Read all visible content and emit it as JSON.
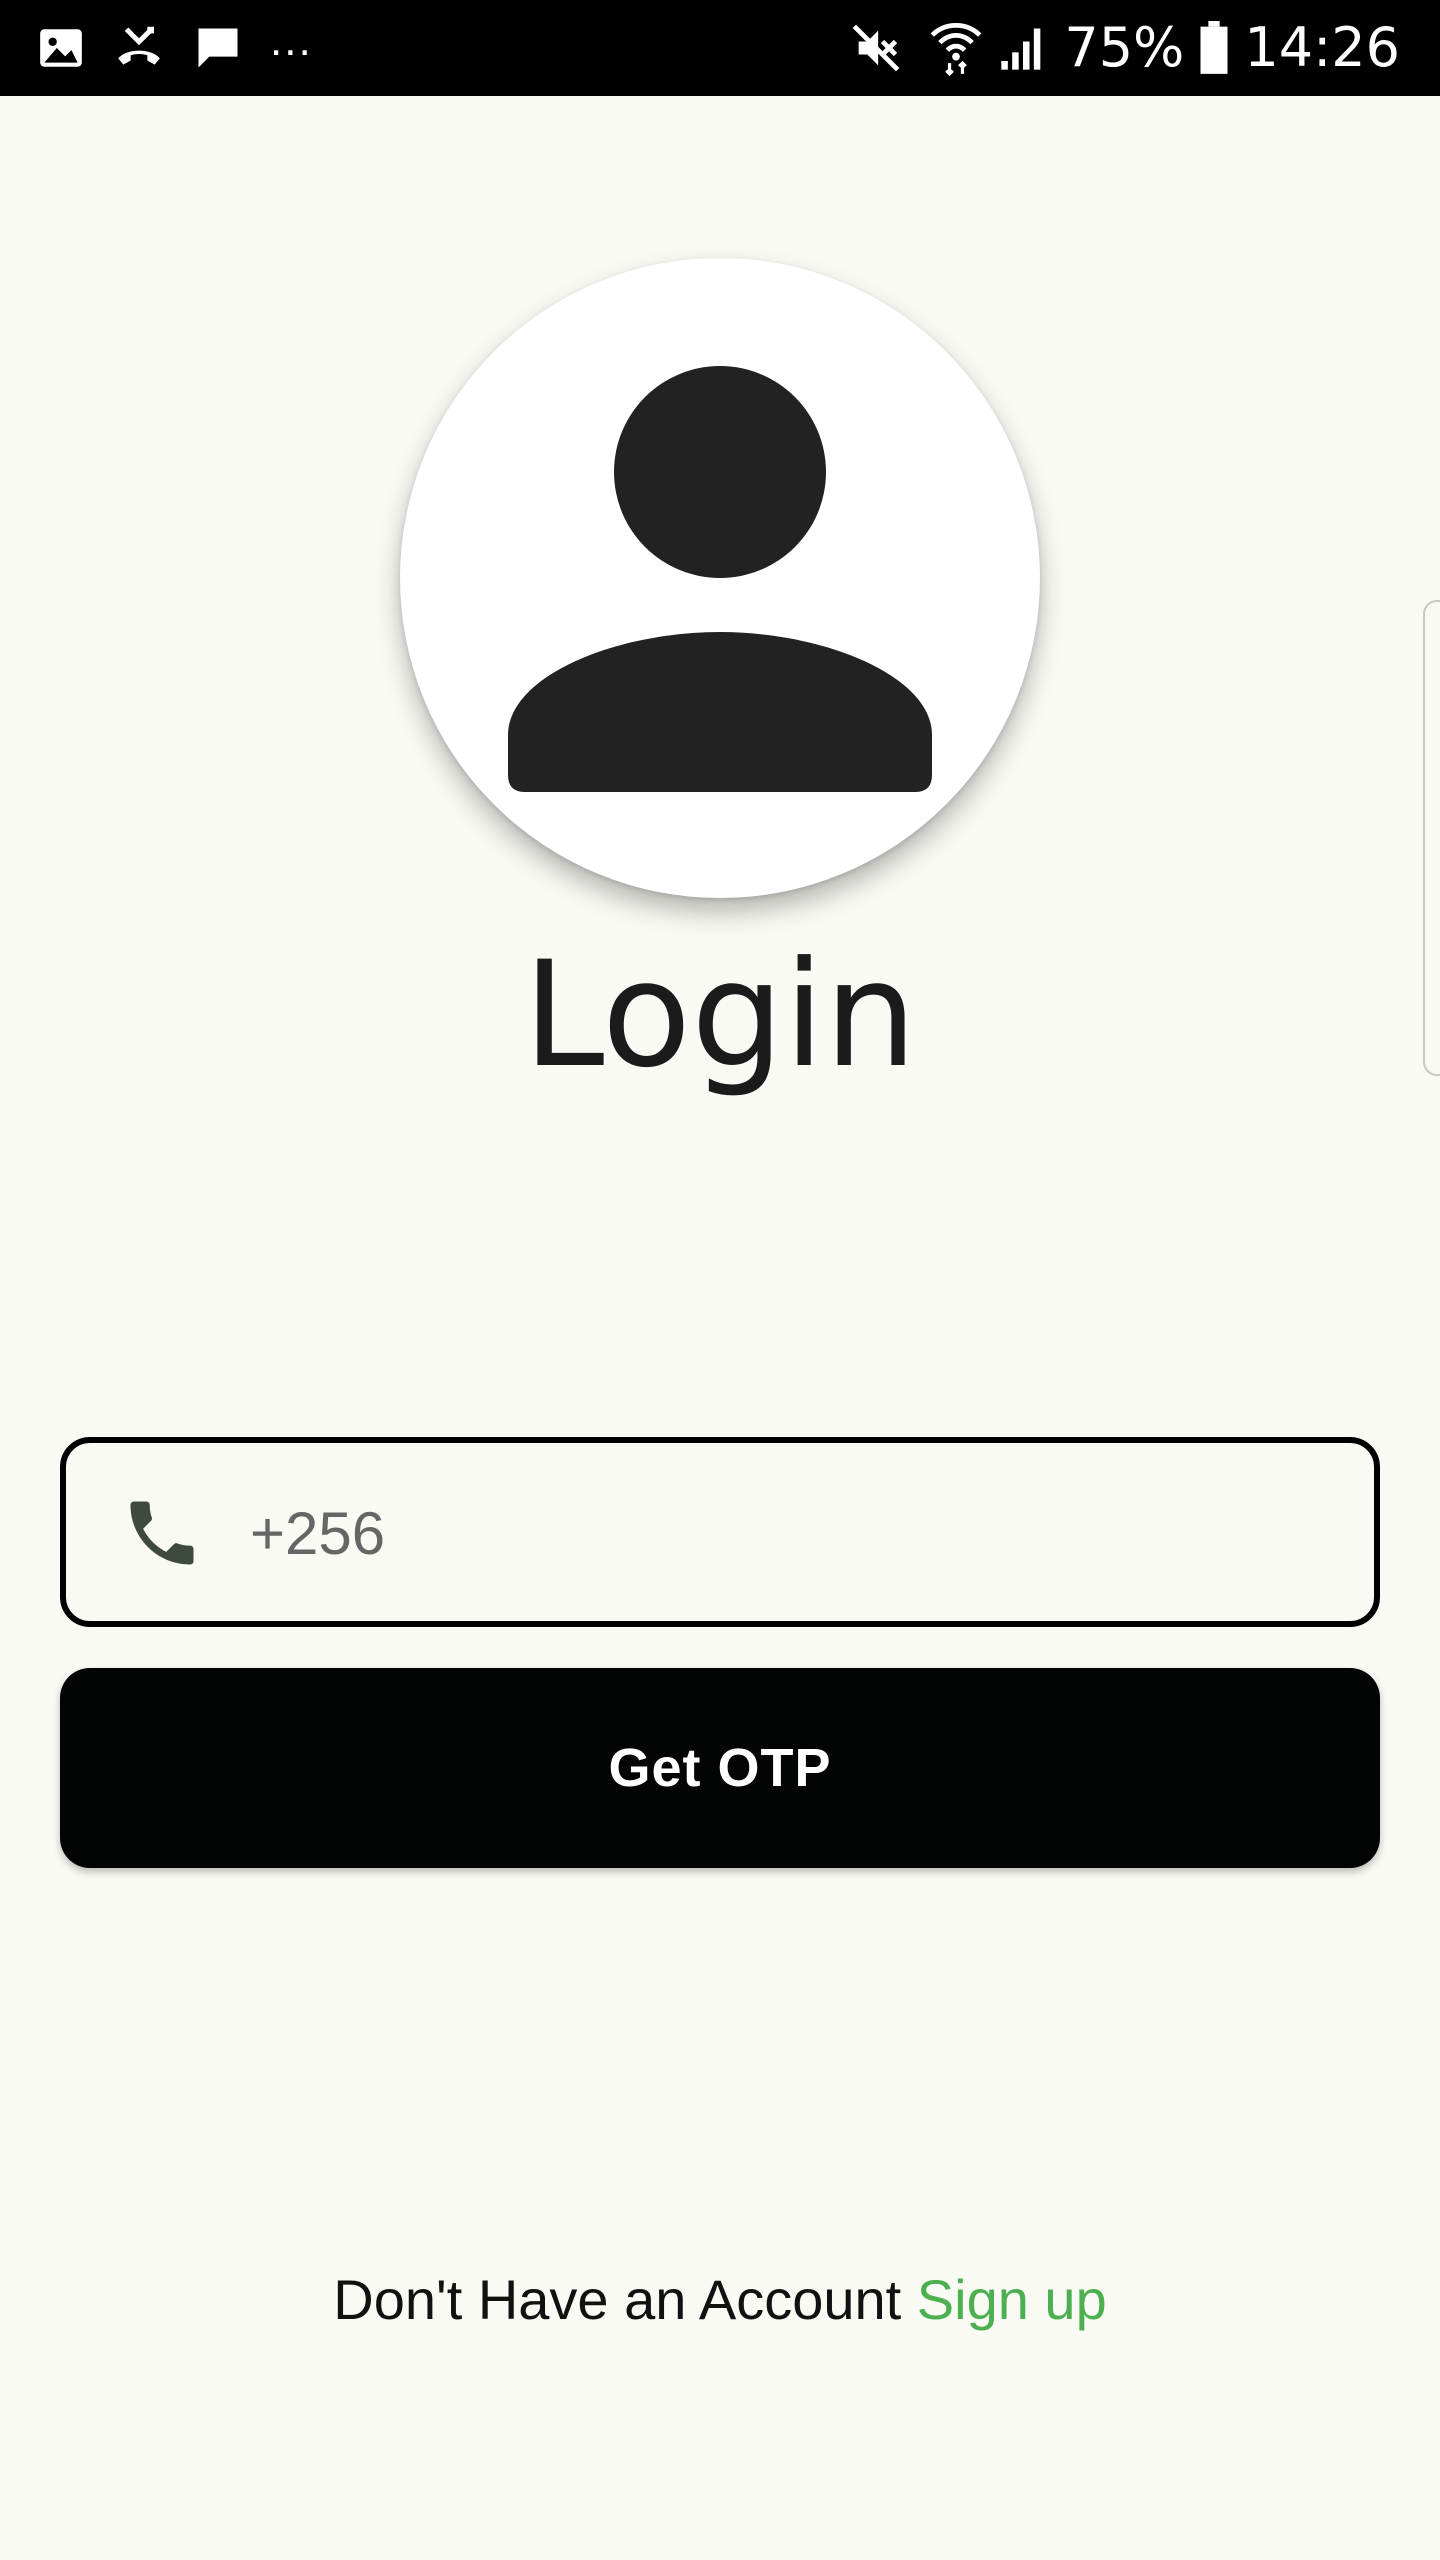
{
  "status_bar": {
    "left_icons": [
      "gallery-icon",
      "missed-call-icon",
      "message-icon"
    ],
    "more_indicator": "...",
    "right_icons": [
      "mute-icon",
      "wifi-icon",
      "signal-icon"
    ],
    "battery_percent": "75%",
    "time": "14:26"
  },
  "avatar": {
    "icon": "person-icon"
  },
  "title": "Login",
  "phone_field": {
    "icon": "phone-icon",
    "placeholder": "+256",
    "value": ""
  },
  "otp_button": {
    "label": "Get OTP"
  },
  "signup": {
    "prompt": "Don't Have an Account",
    "link_label": "Sign up"
  },
  "colors": {
    "background": "#fafaf5",
    "accent_link": "#4caf50",
    "button": "#030504",
    "text": "#1b1b1b",
    "status_bar": "#000000"
  }
}
